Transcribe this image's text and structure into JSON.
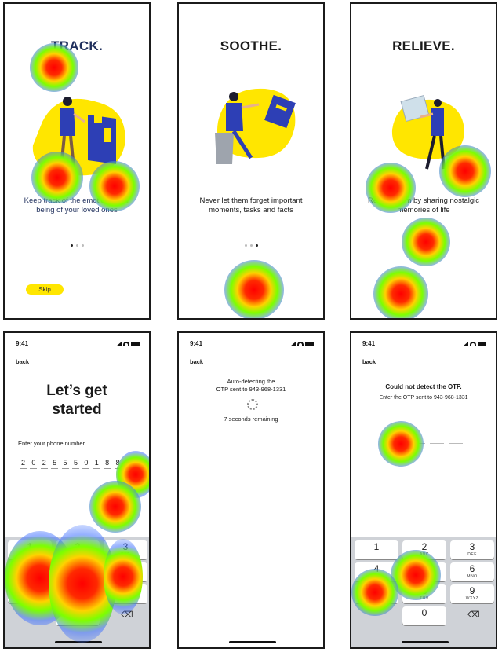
{
  "onboarding": [
    {
      "title": "TRACK.",
      "description": "Keep track of the emotional well being of your loved ones",
      "active_dot": 0,
      "skip_label": "Skip"
    },
    {
      "title": "SOOTHE.",
      "description": "Never let them forget important moments, tasks and facts",
      "active_dot": 2
    },
    {
      "title": "RELIEVE.",
      "description": "Relieve them by sharing nostalgic memories of life"
    }
  ],
  "status_time": "9:41",
  "back_label": "back",
  "signup": {
    "title_line1": "Let’s get",
    "title_line2": "started",
    "phone_label": "Enter your phone number",
    "phone_digits": [
      "2",
      "0",
      "2",
      "5",
      "5",
      "5",
      "0",
      "1",
      "8",
      "8"
    ],
    "keypad": [
      {
        "n": "1",
        "l": ""
      },
      {
        "n": "2",
        "l": "ABC"
      },
      {
        "n": "3",
        "l": "DEF"
      },
      {
        "n": "4",
        "l": "GHI"
      },
      {
        "n": "5",
        "l": "JKL"
      },
      {
        "n": "6",
        "l": "MNO"
      },
      {
        "n": "7",
        "l": "PQRS"
      },
      {
        "n": "8",
        "l": "TUV"
      },
      {
        "n": "9",
        "l": "WXYZ"
      },
      {
        "n": "0",
        "l": ""
      }
    ]
  },
  "autodetect": {
    "line1": "Auto-detecting the",
    "line2": "OTP sent to 943-968-1331",
    "countdown": "7 seconds remaining"
  },
  "otp_fail": {
    "heading": "Could not detect the OTP.",
    "subtext": "Enter the OTP sent to 943-968-1331",
    "keypad": [
      {
        "n": "1",
        "l": ""
      },
      {
        "n": "2",
        "l": "ABC"
      },
      {
        "n": "3",
        "l": "DEF"
      },
      {
        "n": "4",
        "l": "GHI"
      },
      {
        "n": "5",
        "l": "JKL"
      },
      {
        "n": "6",
        "l": "MNO"
      },
      {
        "n": "7",
        "l": "PQRS"
      },
      {
        "n": "8",
        "l": "TUV"
      },
      {
        "n": "9",
        "l": "WXYZ"
      },
      {
        "n": "0",
        "l": ""
      }
    ]
  },
  "colors": {
    "accent_yellow": "#ffe600",
    "illustration_blue": "#2d3fb5",
    "title_navy": "#1f2f5c"
  }
}
